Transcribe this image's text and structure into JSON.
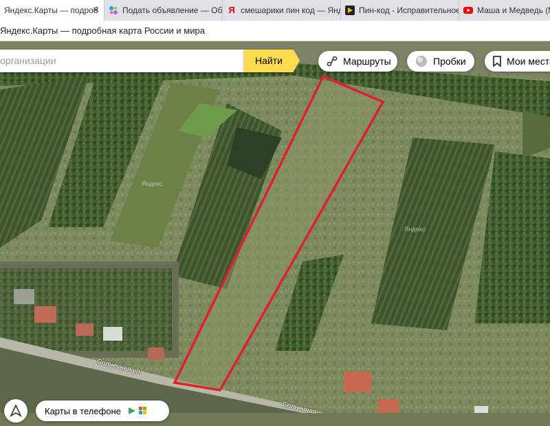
{
  "browser": {
    "tabs": [
      {
        "title": "Яндекс.Карты — подроб",
        "icon": "yandex-maps-favicon-icon",
        "active": true
      },
      {
        "title": "Подать объявление — Объ",
        "icon": "avito-favicon-icon",
        "active": false
      },
      {
        "title": "смешарики пин код — Янд",
        "icon": "yandex-favicon-icon",
        "active": false
      },
      {
        "title": "Пин-код - Исправительное",
        "icon": "play-favicon-icon",
        "active": false
      },
      {
        "title": "Маша и Медведь (M",
        "icon": "youtube-favicon-icon",
        "active": false
      }
    ],
    "page_title": "Яндекс.Карты — подробная карта России и мира"
  },
  "map_ui": {
    "search_placeholder": "организации",
    "find_button": "Найти",
    "routes_button": "Маршруты",
    "traffic_button": "Пробки",
    "my_places_button": "Мои места",
    "app_promo": "Карты в телефоне"
  },
  "map_labels": {
    "street_1": "Солнечная ул.",
    "street_2": "Солнечная",
    "watermark_1": "Яндекс",
    "watermark_2": "Яндекс"
  },
  "colors": {
    "find_button": "#ffdb4d",
    "plot_outline": "#e0202a"
  }
}
